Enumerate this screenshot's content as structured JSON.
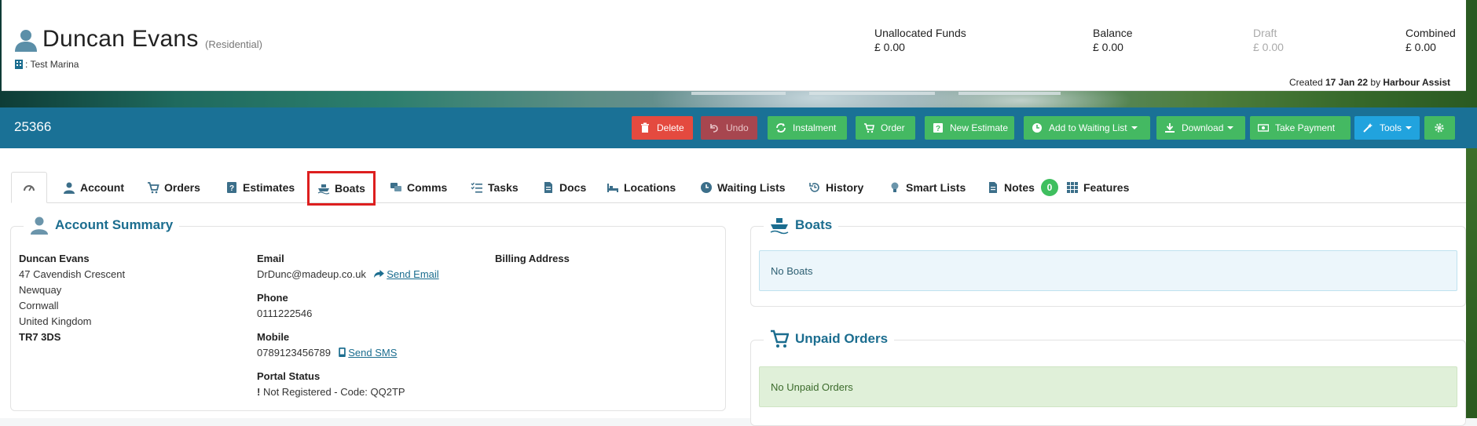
{
  "customer": {
    "name": "Duncan Evans",
    "type": "(Residential)",
    "marina_prefix": ": Test Marina"
  },
  "finance": {
    "unallocated": {
      "label": "Unallocated Funds",
      "value": "£ 0.00"
    },
    "balance": {
      "label": "Balance",
      "value": "£ 0.00"
    },
    "draft": {
      "label": "Draft",
      "value": "£ 0.00"
    },
    "combined": {
      "label": "Combined",
      "value": "£ 0.00"
    }
  },
  "created": {
    "prefix": "Created",
    "date": "17 Jan 22",
    "by": "by",
    "author": "Harbour Assist"
  },
  "account_bar": {
    "number": "25366",
    "buttons": {
      "delete": "Delete",
      "undo": "Undo",
      "instalment": "Instalment",
      "order": "Order",
      "new_estimate": "New Estimate",
      "waiting_list": "Add to Waiting List",
      "download": "Download",
      "take_payment": "Take Payment",
      "tools": "Tools"
    }
  },
  "tabs": {
    "account": "Account",
    "orders": "Orders",
    "estimates": "Estimates",
    "boats": "Boats",
    "comms": "Comms",
    "tasks": "Tasks",
    "docs": "Docs",
    "locations": "Locations",
    "waiting_lists": "Waiting Lists",
    "history": "History",
    "smart_lists": "Smart Lists",
    "notes": "Notes",
    "notes_count": "0",
    "features": "Features"
  },
  "summary": {
    "title": "Account Summary",
    "address": {
      "name": "Duncan Evans",
      "line1": "47 Cavendish Crescent",
      "line2": "Newquay",
      "line3": "Cornwall",
      "line4": "United Kingdom",
      "postcode": "TR7 3DS"
    },
    "email_label": "Email",
    "email_value": "DrDunc@madeup.co.uk",
    "send_email": "Send Email",
    "phone_label": "Phone",
    "phone_value": "0111222546",
    "mobile_label": "Mobile",
    "mobile_value": "0789123456789",
    "send_sms": "Send SMS",
    "portal_label": "Portal Status",
    "portal_value": "Not Registered - Code: QQ2TP",
    "billing_label": "Billing Address"
  },
  "boats_panel": {
    "title": "Boats",
    "empty": "No Boats"
  },
  "orders_panel": {
    "title": "Unpaid Orders",
    "empty": "No Unpaid Orders"
  },
  "colors": {
    "bar": "#1a7196",
    "accent": "#1b6d8f",
    "danger": "#e44a3f",
    "success": "#44b962",
    "info": "#21a3de",
    "highlight": "#dd1f1f"
  }
}
